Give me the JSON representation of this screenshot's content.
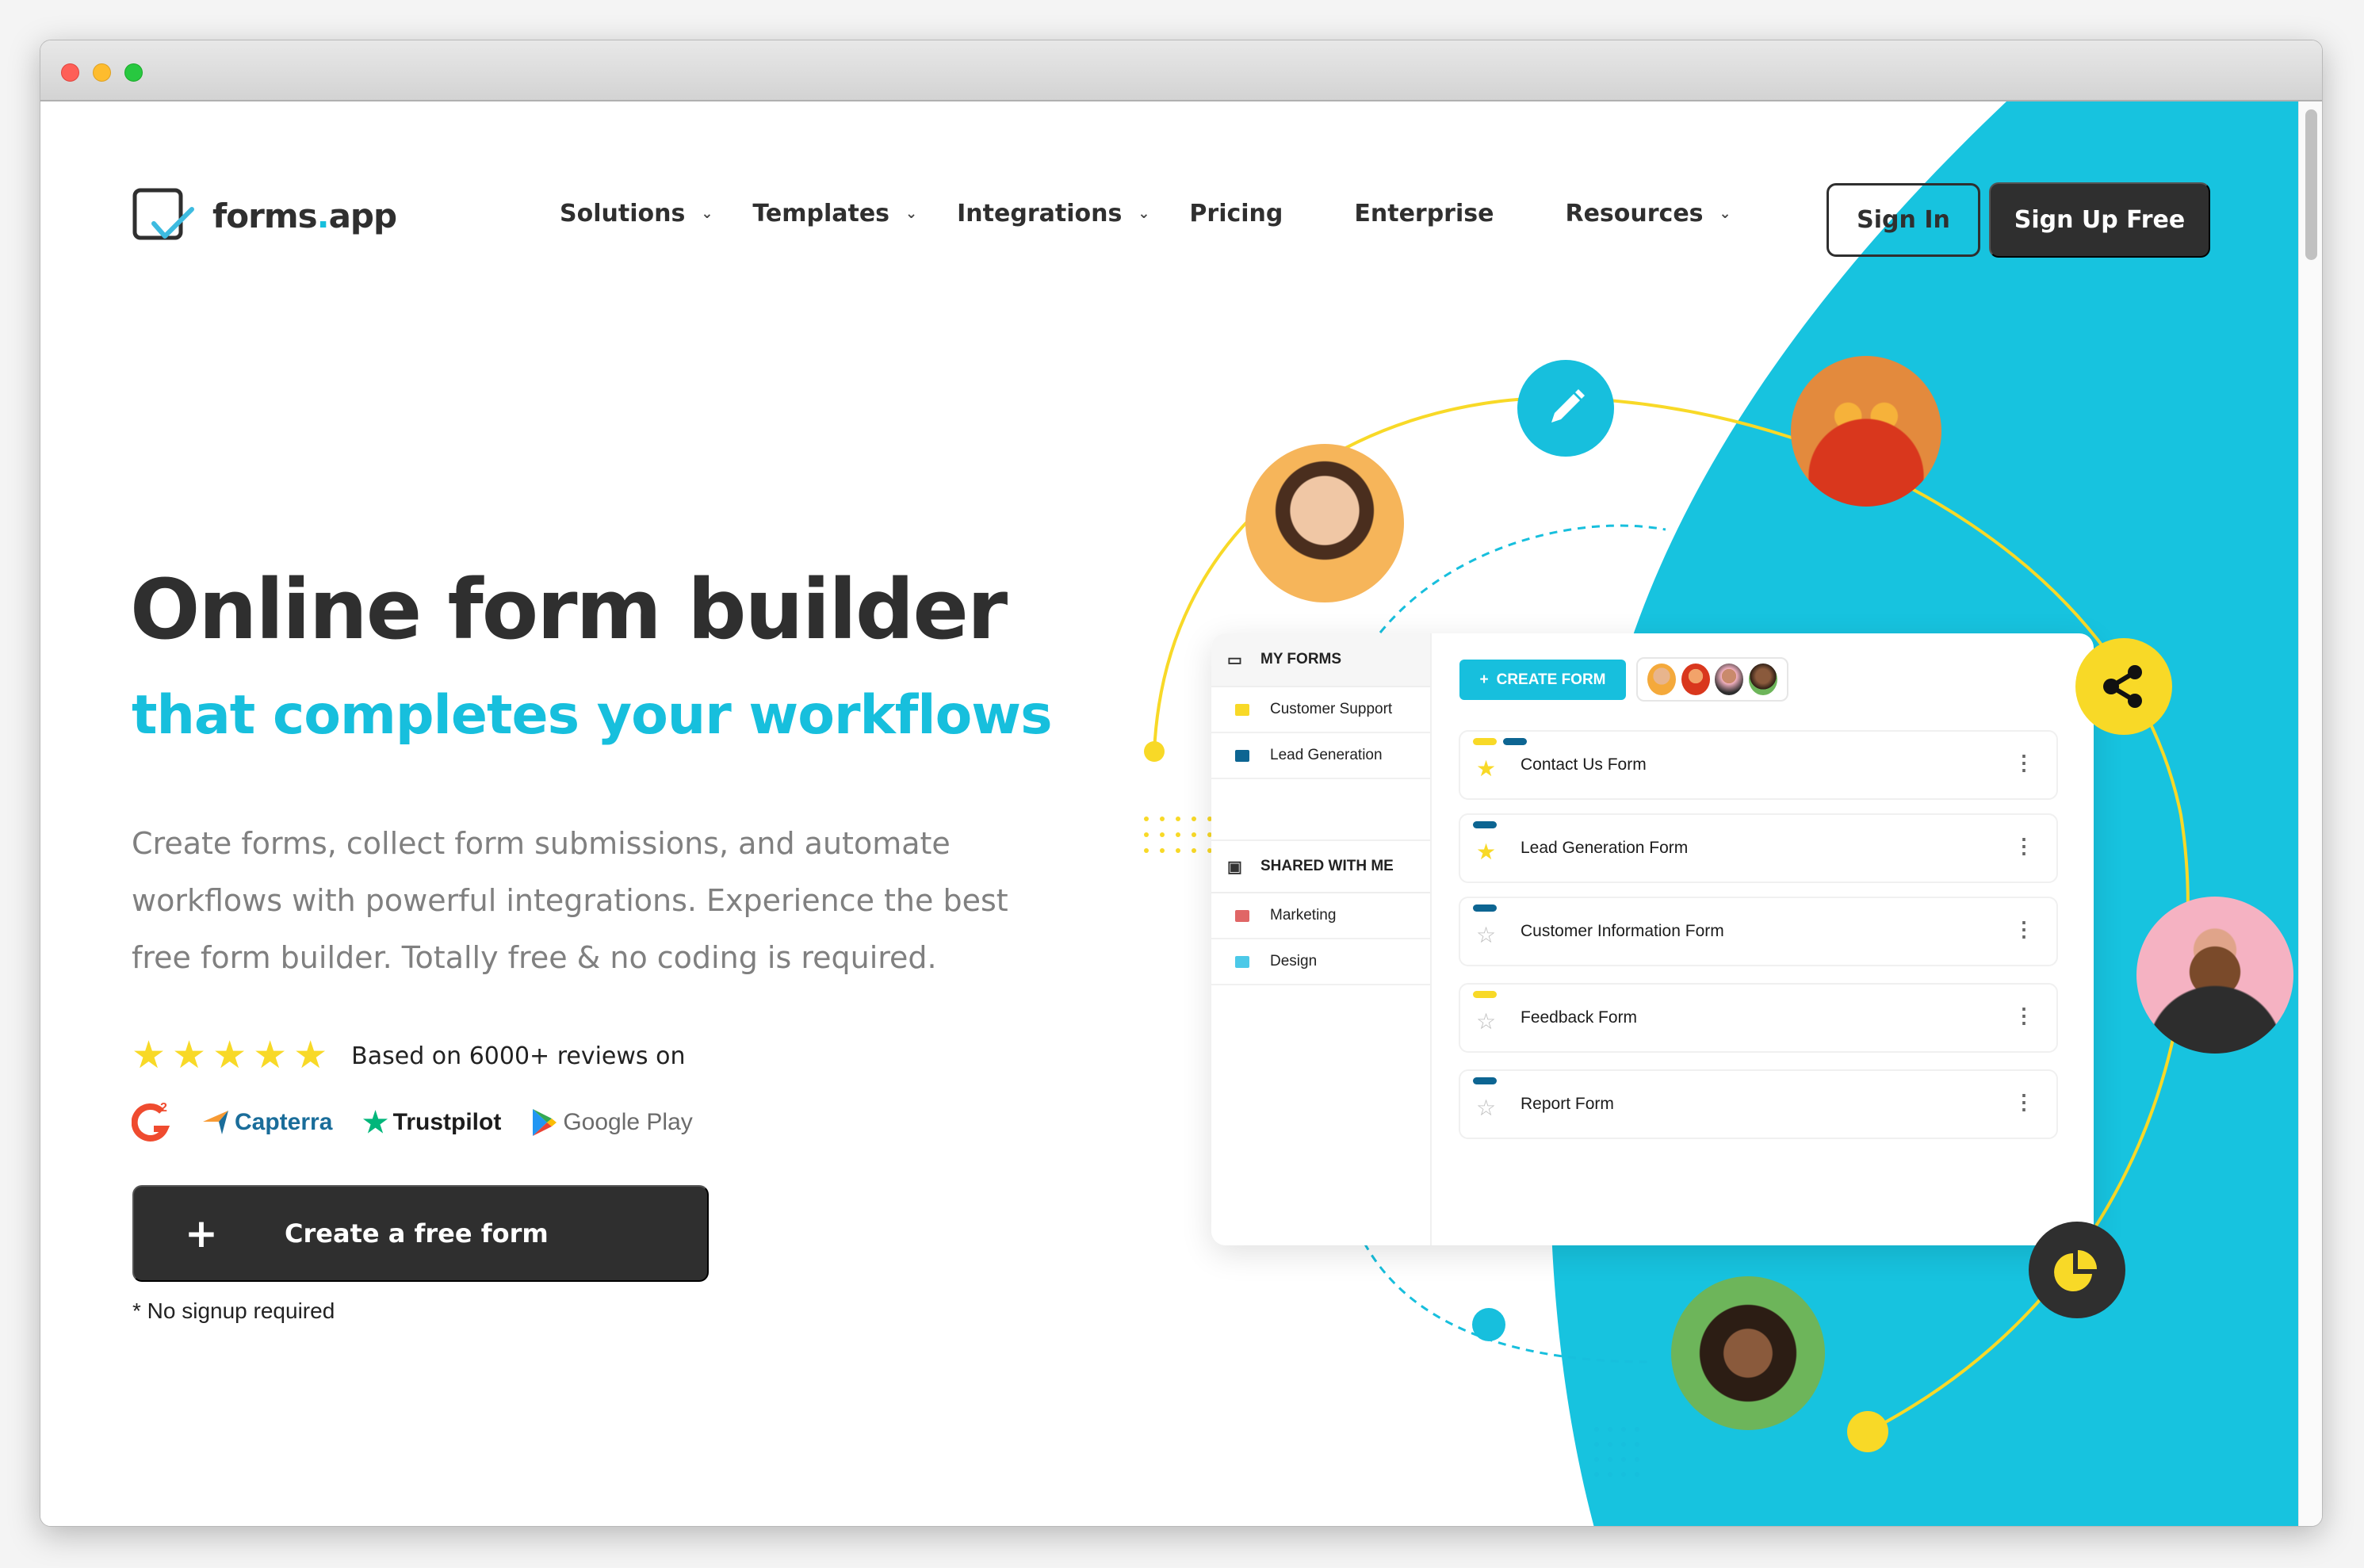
{
  "window": {
    "traffic_lights": [
      "close",
      "minimize",
      "maximize"
    ]
  },
  "header": {
    "logo_text": "forms",
    "logo_dot": ".",
    "logo_suffix": "app",
    "nav": [
      {
        "label": "Solutions",
        "dropdown": true
      },
      {
        "label": "Templates",
        "dropdown": true
      },
      {
        "label": "Integrations",
        "dropdown": true
      },
      {
        "label": "Pricing",
        "dropdown": false
      },
      {
        "label": "Enterprise",
        "dropdown": false
      },
      {
        "label": "Resources",
        "dropdown": true
      }
    ],
    "chevron": "⌄",
    "sign_in": "Sign In",
    "sign_up": "Sign Up Free"
  },
  "hero": {
    "title": "Online form builder",
    "subtitle": "that completes your workflows",
    "description": "Create forms, collect form submissions, and automate workflows with powerful integrations. Experience the best free form builder. Totally free & no coding is required.",
    "rating_stars": 5,
    "star_glyph": "★",
    "rating_text": "Based on 6000+ reviews on",
    "review_sites": [
      "G2",
      "Capterra",
      "Trustpilot",
      "Google Play"
    ],
    "cta_icon": "+",
    "cta_label": "Create a free form",
    "note": "* No signup required"
  },
  "illustration": {
    "sidebar": {
      "my_forms": "MY FORMS",
      "my_forms_items": [
        {
          "label": "Customer Support",
          "color": "#f8d927"
        },
        {
          "label": "Lead Generation",
          "color": "#0d6592"
        }
      ],
      "shared": "SHARED WITH ME",
      "shared_items": [
        {
          "label": "Marketing",
          "color": "#e06666"
        },
        {
          "label": "Design",
          "color": "#4cc9e8"
        }
      ]
    },
    "create_form_label": "CREATE FORM",
    "create_form_icon": "+",
    "forms": [
      {
        "name": "Contact Us Form",
        "starred": true,
        "tags": [
          "#f8d927",
          "#0d6592"
        ]
      },
      {
        "name": "Lead Generation Form",
        "starred": true,
        "tags": [
          "#0d6592"
        ]
      },
      {
        "name": "Customer Information Form",
        "starred": false,
        "tags": [
          "#0d6592"
        ]
      },
      {
        "name": "Feedback Form",
        "starred": false,
        "tags": [
          "#f8d927"
        ]
      },
      {
        "name": "Report Form",
        "starred": false,
        "tags": [
          "#0d6592"
        ]
      }
    ],
    "kebab_glyph": "⋮",
    "orbit_icons": [
      "pencil-icon",
      "share-icon",
      "pie-chart-icon"
    ]
  },
  "colors": {
    "accent": "#17bfdd",
    "dark": "#2f2f2f",
    "yellow": "#f8d927",
    "navy": "#0d6592"
  }
}
